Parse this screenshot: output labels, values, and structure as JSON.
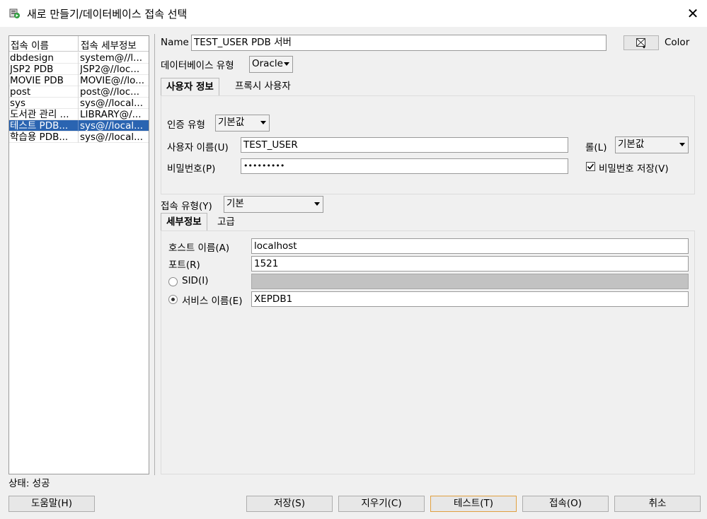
{
  "window": {
    "title": "새로 만들기/데이터베이스 접속 선택"
  },
  "list": {
    "headers": [
      "접속 이름",
      "접속 세부정보"
    ],
    "rows": [
      [
        "dbdesign",
        "system@//l..."
      ],
      [
        "JSP2 PDB",
        "JSP2@//loc..."
      ],
      [
        "MOVIE PDB",
        "MOVIE@//lo..."
      ],
      [
        "post",
        "post@//loc..."
      ],
      [
        "sys",
        "sys@//local..."
      ],
      [
        "도서관 관리 ...",
        "LIBRARY@/..."
      ],
      [
        "테스트 PDB...",
        "sys@//local..."
      ],
      [
        "학습용 PDB...",
        "sys@//local..."
      ]
    ],
    "selected_index": 6
  },
  "form": {
    "name_label": "Name",
    "name_value": "TEST_USER PDB 서버",
    "color_label": "Color",
    "dbtype_label": "데이터베이스 유형",
    "dbtype_value": "Oracle",
    "tabs": [
      "사용자 정보",
      "프록시 사용자"
    ],
    "auth_label": "인증 유형",
    "auth_value": "기본값",
    "user_label": "사용자 이름(U)",
    "user_value": "TEST_USER",
    "role_label": "롤(L)",
    "role_value": "기본값",
    "password_label": "비밀번호(P)",
    "password_value": "•••••••••",
    "save_password_label": "비밀번호 저장(V)",
    "save_password_checked": true,
    "conn_type_label": "접속 유형(Y)",
    "conn_type_value": "기본",
    "detail_tabs": [
      "세부정보",
      "고급"
    ],
    "host_label": "호스트 이름(A)",
    "host_value": "localhost",
    "port_label": "포트(R)",
    "port_value": "1521",
    "sid_label": "SID(I)",
    "service_label": "서비스 이름(E)",
    "service_value": "XEPDB1",
    "selected_radio": "service"
  },
  "status": {
    "text": "상태: 성공"
  },
  "buttons": {
    "help": "도움말(H)",
    "save": "저장(S)",
    "clear": "지우기(C)",
    "test": "테스트(T)",
    "connect": "접속(O)",
    "cancel": "취소"
  }
}
